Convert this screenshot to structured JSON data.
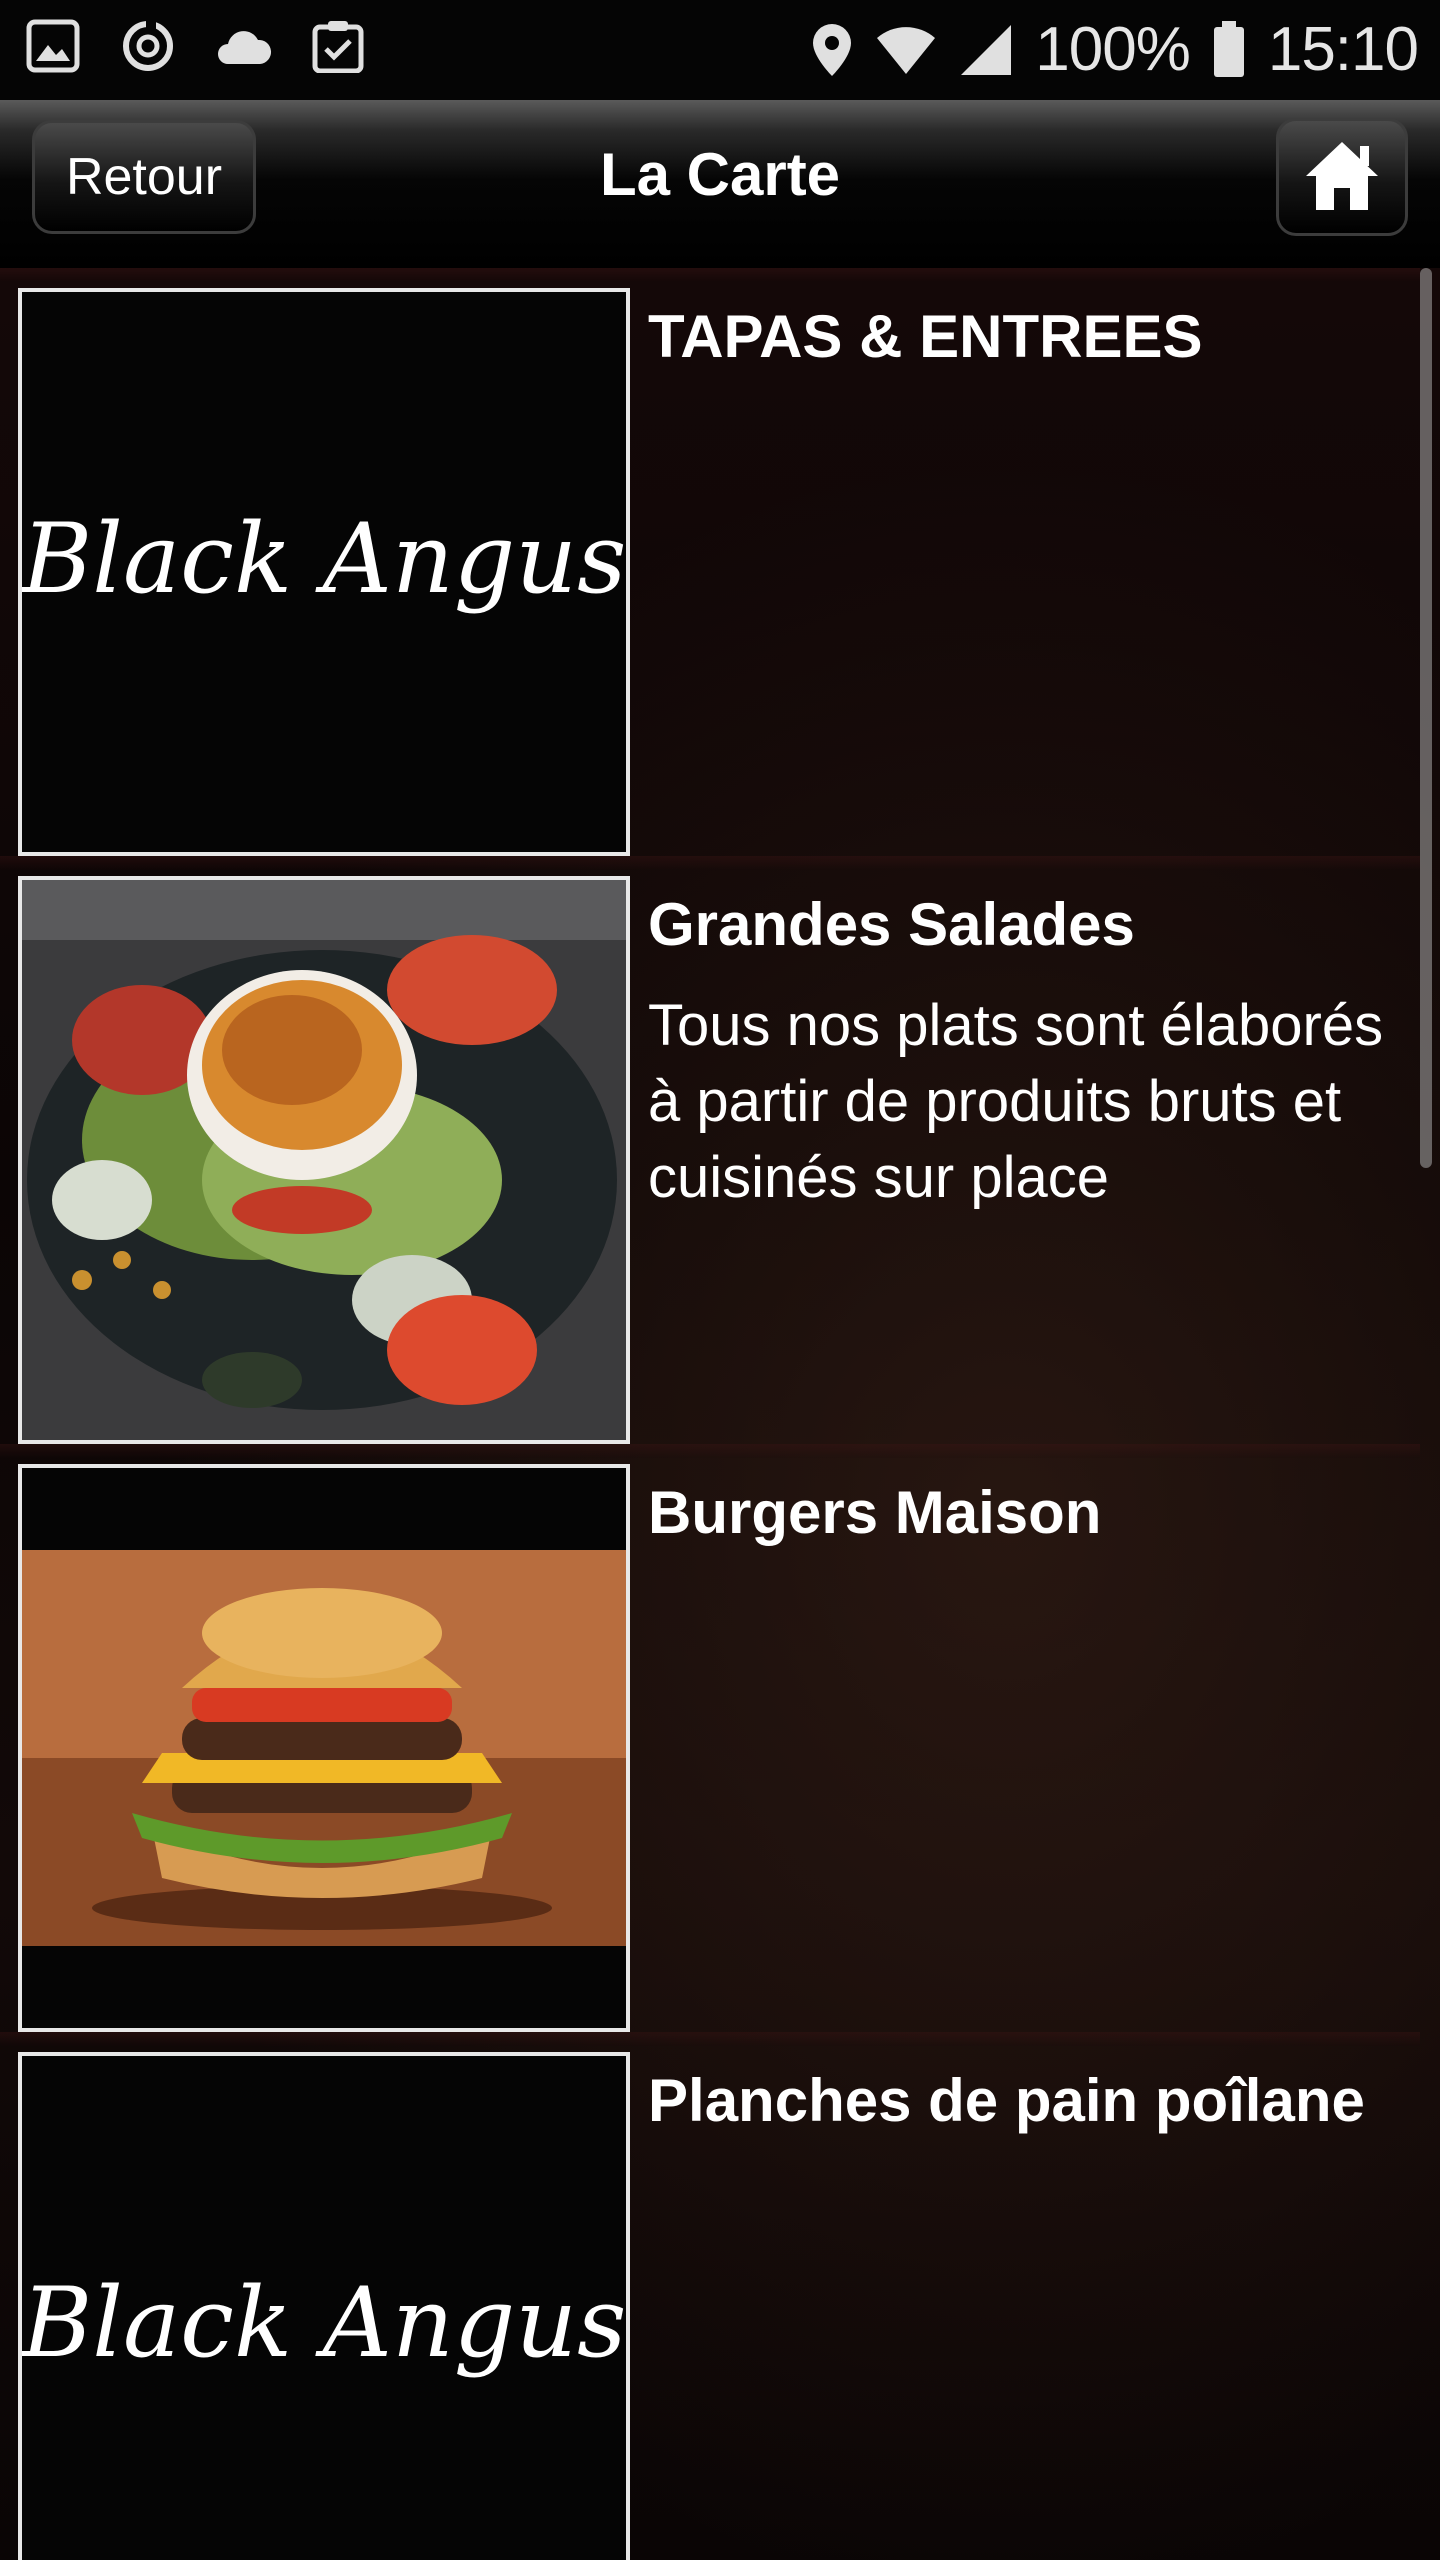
{
  "status_bar": {
    "battery": "100%",
    "time": "15:10",
    "icons": [
      "gallery-icon",
      "sync-icon",
      "cloud-icon",
      "clipboard-check-icon",
      "location-icon",
      "wifi-icon",
      "signal-icon",
      "battery-icon"
    ]
  },
  "header": {
    "back_label": "Retour",
    "title": "La Carte",
    "home_icon": "home-icon"
  },
  "menu": {
    "items": [
      {
        "title": "TAPAS & ENTREES",
        "description": "",
        "image": "black-angus-logo"
      },
      {
        "title": "Grandes Salades",
        "description": "Tous nos plats sont élaborés à partir de produits bruts et cuisinés sur place",
        "image": "salad-photo"
      },
      {
        "title": "Burgers Maison",
        "description": "",
        "image": "burger-photo"
      },
      {
        "title": "Planches de pain poîlane",
        "description": "",
        "image": "black-angus-logo"
      }
    ],
    "logo_text": "Black Angus"
  },
  "colors": {
    "background": "#000000",
    "thumb_border": "#e8e8e8",
    "text": "#ffffff"
  }
}
